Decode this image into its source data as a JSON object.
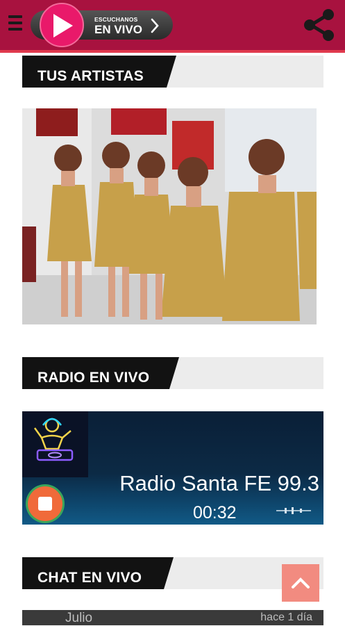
{
  "header": {
    "live_small": "ESCUCHANOS",
    "live_big": "EN VIVO",
    "brand_color": "#a8123f",
    "accent_color": "#e9196a",
    "icons": {
      "menu": "hamburger-menu-icon",
      "play": "play-icon",
      "chevron": "chevron-right-icon",
      "share": "share-icon"
    }
  },
  "sections": {
    "artists": {
      "title": "TUS ARTISTAS"
    },
    "radio": {
      "title": "RADIO EN VIVO"
    },
    "chat": {
      "title": "CHAT EN VIVO"
    }
  },
  "player": {
    "station": "Radio Santa FE 99.3",
    "elapsed": "00:32",
    "state": "playing",
    "icons": {
      "thumbnail": "dj-turntable-icon",
      "stop": "stop-icon",
      "waveform": "audio-wave-icon"
    }
  },
  "chat": {
    "messages": [
      {
        "user": "Julio",
        "time": "hace 1 día"
      }
    ],
    "scroll_top_icon": "chevron-up-icon"
  }
}
